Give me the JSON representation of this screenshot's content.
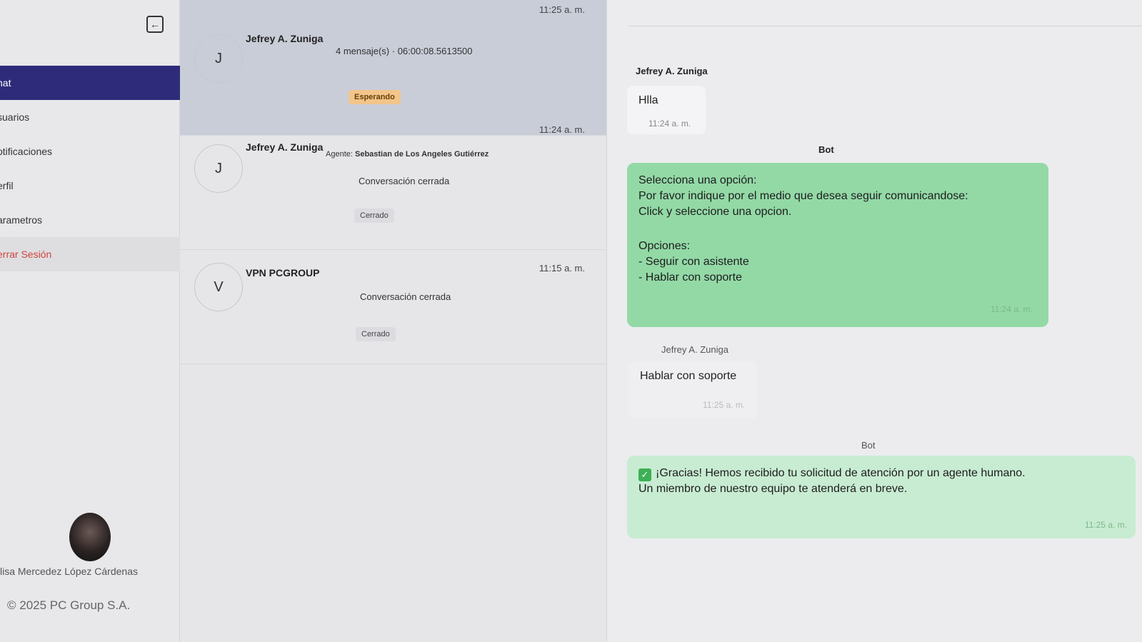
{
  "sidebar": {
    "collapse_icon": "←",
    "items": [
      {
        "label": "hat"
      },
      {
        "label": "suarios"
      },
      {
        "label": "otificaciones"
      },
      {
        "label": "erfil"
      },
      {
        "label": "arametros"
      },
      {
        "label": "errar Sesión"
      }
    ],
    "user_name": "lisa Mercedez López Cárdenas",
    "footer": "© 2025 PC Group S.A."
  },
  "conversations": [
    {
      "initial": "J",
      "name": "Jefrey A. Zuniga",
      "time": "11:25 a. m.",
      "meta": "4 mensaje(s) · 06:00:08.5613500",
      "status": "Esperando"
    },
    {
      "initial": "J",
      "name": "Jefrey A. Zuniga",
      "time": "11:24 a. m.",
      "agent_label": "Agente:",
      "agent_name": "Sebastian de Los Angeles Gutiérrez",
      "last_message": "Conversación cerrada",
      "status": "Cerrado"
    },
    {
      "initial": "V",
      "name": "VPN PCGROUP",
      "time": "11:15 a. m.",
      "last_message": "Conversación cerrada",
      "status": "Cerrado"
    }
  ],
  "chat": {
    "messages": [
      {
        "sender": "Jefrey A. Zuniga",
        "text": "Hlla",
        "time": "11:24 a. m."
      },
      {
        "sender": "Bot",
        "lines": [
          "Selecciona una opción:",
          "Por favor indique por el medio que desea seguir comunicandose:",
          "Click y seleccione una opcion.",
          "",
          "Opciones:",
          "- Seguir con asistente",
          "- Hablar con soporte"
        ],
        "time": "11:24 a. m."
      },
      {
        "sender": "Jefrey A. Zuniga",
        "text": "Hablar con soporte",
        "time": "11:25 a. m."
      },
      {
        "sender": "Bot",
        "icon": "check-icon",
        "lines": [
          "¡Gracias! Hemos recibido tu solicitud de atención por un agente humano.",
          "Un miembro de nuestro equipo te atenderá en breve."
        ],
        "time": "11:25 a. m."
      }
    ]
  },
  "colors": {
    "sidebar_active": "#2e2c7a",
    "logout": "#d0443c",
    "bot_bubble": "#93d9a6",
    "badge_waiting": "#f2c58a"
  }
}
